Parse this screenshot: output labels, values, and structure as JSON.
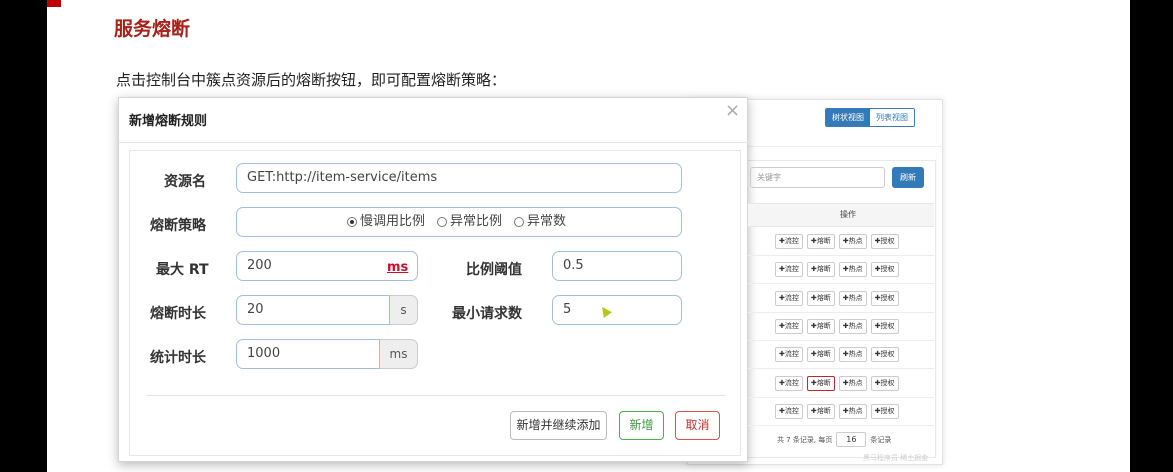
{
  "slide": {
    "heading": "服务熔断",
    "intro": "点击控制台中簇点资源后的熔断按钮，即可配置熔断策略："
  },
  "background_panel": {
    "view_tree": "树状视图",
    "view_list": "列表视图",
    "keyword_placeholder": "关键字",
    "refresh_label": "刷新",
    "ops_header": "操作",
    "row_buttons": [
      "✚流控",
      "✚熔断",
      "✚热点",
      "✚授权"
    ],
    "row_count": 7,
    "selected_row_index": 5,
    "pager": {
      "total_text": "共 7 条记录, 每页",
      "page_size": "16",
      "unit_text": "条记录"
    },
    "watermark": "黑马程序员 稀土掘金"
  },
  "modal": {
    "title": "新增熔断规则",
    "close_glyph": "×",
    "resource_label": "资源名",
    "resource_value": "GET:http://item-service/items",
    "strategy_label": "熔断策略",
    "strategy_options": [
      "慢调用比例",
      "异常比例",
      "异常数"
    ],
    "strategy_selected_index": 0,
    "max_rt_label": "最大 RT",
    "max_rt_value": "200",
    "max_rt_unit": "ms",
    "ratio_label": "比例阈值",
    "ratio_value": "0.5",
    "duration_label": "熔断时长",
    "duration_value": "20",
    "duration_unit": "s",
    "min_request_label": "最小请求数",
    "min_request_value": "5",
    "stat_label": "统计时长",
    "stat_value": "1000",
    "stat_unit": "ms",
    "btn_add_continue": "新增并继续添加",
    "btn_add": "新增",
    "btn_cancel": "取消"
  },
  "colors": {
    "heading": "#a8201a",
    "primary": "#337ab7",
    "add_green": "#3c9a3c",
    "cancel_red": "#c9302c",
    "selected_outline": "#c0262d"
  }
}
